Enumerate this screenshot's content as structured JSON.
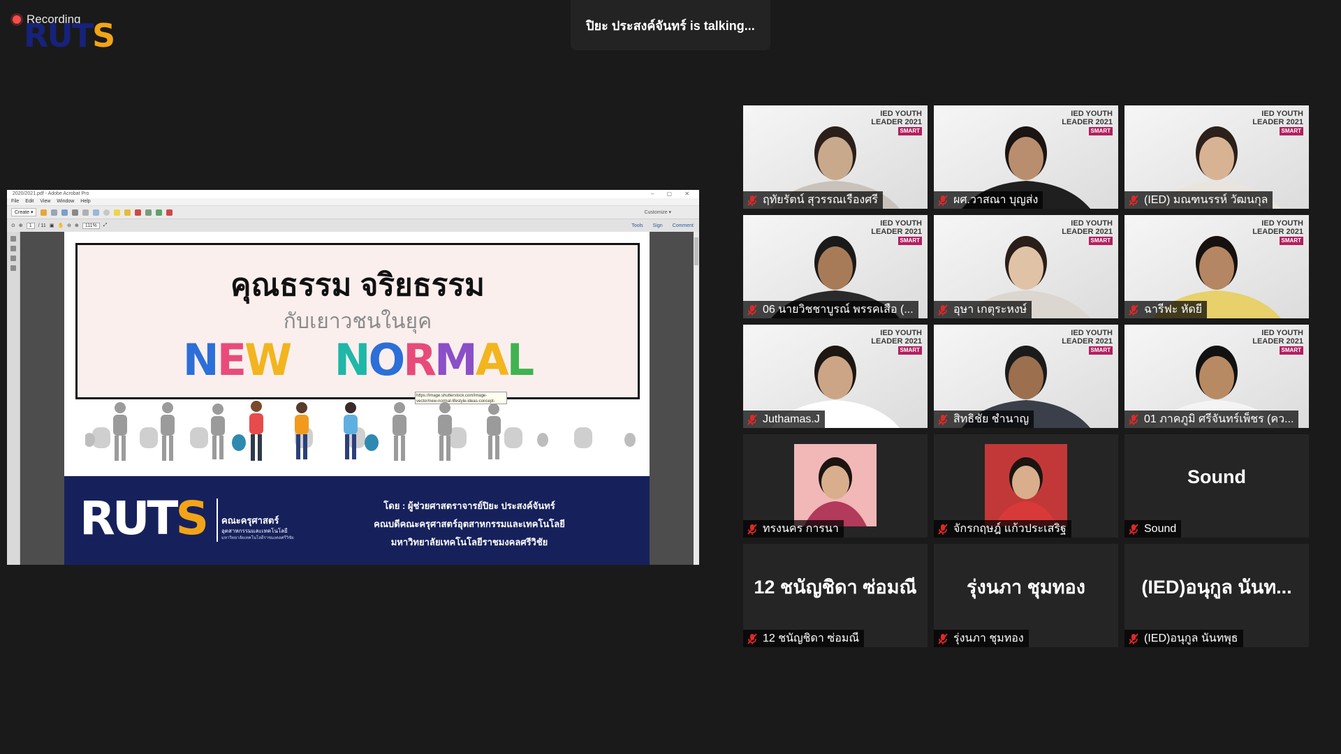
{
  "recording": {
    "label": "Recording"
  },
  "watermark": {
    "logo_a": "RUT",
    "logo_b": "S"
  },
  "banner": {
    "talking": "ปิยะ ประสงค์จันทร์ is talking..."
  },
  "acrobat": {
    "title": "2020/2021.pdf - Adobe Acrobat Pro",
    "menu": [
      "File",
      "Edit",
      "View",
      "Window",
      "Help"
    ],
    "create": "Create",
    "customize": "Customize",
    "page_current": "1",
    "page_total": "/ 11",
    "zoom": "111%",
    "tools": "Tools",
    "sign": "Sign",
    "comment": "Comment"
  },
  "slide": {
    "title": "คุณธรรม จริยธรรม",
    "subtitle": "กับเยาวชนในยุค",
    "tagline": "NEW NORMAL",
    "tooltip": "https://image.shutterstock.com/image-vector/new-normal-lifestyle-ideas-concept-260nw-1884005911.jpg",
    "logo_a": "RUT",
    "logo_b": "S",
    "faculty": "คณะครุศาสตร์",
    "faculty_sub": "อุตสาหกรรมและเทคโนโลยี",
    "university_sub": "มหาวิทยาลัยเทคโนโลยีราชมงคลศรีวิชัย",
    "presenter_lines": [
      "โดย : ผู้ช่วยศาสตราจารย์ปิยะ ประสงค์จันทร์",
      "คณบดีคณะครุศาสตร์อุตสาหกรรมและเทคโนโลยี",
      "มหาวิทยาลัยเทคโนโลยีราชมงคลศรีวิชัย"
    ]
  },
  "wall": {
    "line1": "IED YOUTH",
    "line2": "LEADER 2021",
    "line3": "SMART"
  },
  "participants": [
    {
      "name": "ฤทัยรัตน์ สุวรรณเรืองศรี",
      "mode": "video"
    },
    {
      "name": "ผศ.วาสณา บุญส่ง",
      "mode": "video"
    },
    {
      "name": "(IED) มณฑนรรห์ วัฒนกุล",
      "mode": "video"
    },
    {
      "name": "06 นายวิชชาบูรณ์ พรรคเสือ (...",
      "mode": "video"
    },
    {
      "name": "อุษา เกตุระหงษ์",
      "mode": "video"
    },
    {
      "name": "ฉารีฟะ หัดยี",
      "mode": "video"
    },
    {
      "name": "Juthamas.J",
      "mode": "video"
    },
    {
      "name": "สิทธิชัย ชำนาญ",
      "mode": "video"
    },
    {
      "name": "01 ภาคภูมิ ศรีจันทร์เพ็ชร (คว...",
      "mode": "video"
    },
    {
      "name": "ทรงนคร การนา",
      "mode": "avatar"
    },
    {
      "name": "จักรกฤษฎ์ แก้วประเสริฐ",
      "mode": "avatar"
    },
    {
      "name": "Sound",
      "mode": "text",
      "big": "Sound"
    },
    {
      "name": "12 ชนัญชิดา ซ่อมณี",
      "mode": "text",
      "big": "12 ชนัญชิดา ซ่อมณี"
    },
    {
      "name": "รุ่งนภา ชุมทอง",
      "mode": "text",
      "big": "รุ่งนภา ชุมทอง"
    },
    {
      "name": "(IED)อนุกูล นันทพุธ",
      "mode": "text",
      "big": "(IED)อนุกูล นันท..."
    }
  ],
  "colors": {
    "background": "#1a1a1a",
    "tile": "#252525",
    "muted_icon": "#e02828",
    "brand_navy": "#16215c",
    "brand_yellow": "#f2a417"
  }
}
